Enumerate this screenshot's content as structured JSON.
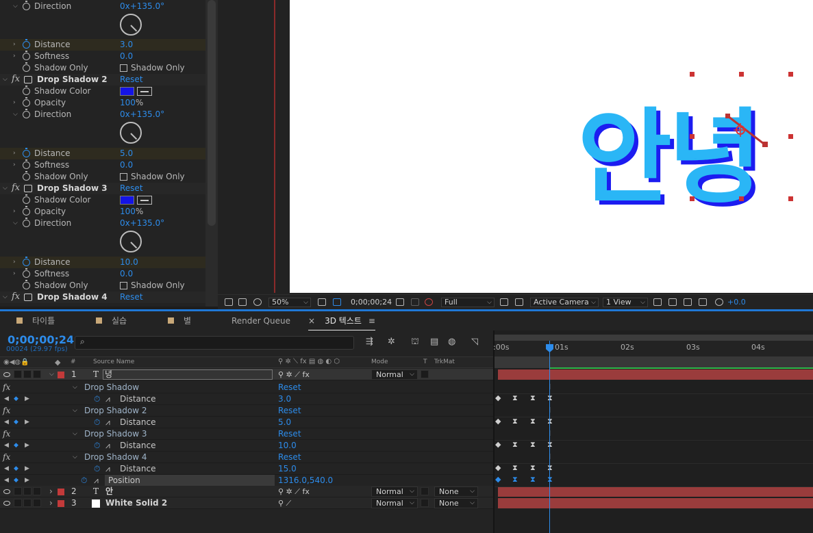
{
  "effect_controls": {
    "rows": [
      {
        "type": "prop",
        "twirl": "open",
        "label": "Direction",
        "value": "0x+135.0°"
      },
      {
        "type": "prop",
        "twirl": "closed",
        "label": "Distance",
        "value": "3.0",
        "stopwatch_on": true,
        "highlight": true
      },
      {
        "type": "prop",
        "twirl": "closed",
        "label": "Softness",
        "value": "0.0"
      },
      {
        "type": "check",
        "label": "Shadow Only",
        "check_label": "Shadow Only"
      },
      {
        "type": "effect",
        "name": "Drop Shadow 2",
        "reset": "Reset"
      },
      {
        "type": "color",
        "label": "Shadow Color",
        "color": "#1414e6"
      },
      {
        "type": "prop",
        "twirl": "closed",
        "label": "Opacity",
        "value": "100",
        "unit": "%"
      },
      {
        "type": "prop",
        "twirl": "open",
        "label": "Direction",
        "value": "0x+135.0°"
      },
      {
        "type": "prop",
        "twirl": "closed",
        "label": "Distance",
        "value": "5.0",
        "stopwatch_on": true,
        "highlight": true
      },
      {
        "type": "prop",
        "twirl": "closed",
        "label": "Softness",
        "value": "0.0"
      },
      {
        "type": "check",
        "label": "Shadow Only",
        "check_label": "Shadow Only"
      },
      {
        "type": "effect",
        "name": "Drop Shadow 3",
        "reset": "Reset"
      },
      {
        "type": "color",
        "label": "Shadow Color",
        "color": "#1414e6"
      },
      {
        "type": "prop",
        "twirl": "closed",
        "label": "Opacity",
        "value": "100",
        "unit": "%"
      },
      {
        "type": "prop",
        "twirl": "open",
        "label": "Direction",
        "value": "0x+135.0°"
      },
      {
        "type": "prop",
        "twirl": "closed",
        "label": "Distance",
        "value": "10.0",
        "stopwatch_on": true,
        "highlight": true
      },
      {
        "type": "prop",
        "twirl": "closed",
        "label": "Softness",
        "value": "0.0"
      },
      {
        "type": "check",
        "label": "Shadow Only",
        "check_label": "Shadow Only"
      },
      {
        "type": "effect",
        "name": "Drop Shadow 4",
        "reset": "Reset"
      }
    ]
  },
  "canvas": {
    "text": "안녕",
    "text_color": "#29b6f6",
    "shadow_color": "#1a1af0"
  },
  "viewer_bar": {
    "zoom": "50%",
    "timecode": "0;00;00;24",
    "resolution": "Full",
    "camera": "Active Camera",
    "views": "1 View",
    "exposure": "+0.0"
  },
  "tabs": [
    {
      "label": "타이틀",
      "color": "#c8a878"
    },
    {
      "label": "실습",
      "color": "#c8a878"
    },
    {
      "label": "별",
      "color": "#c8a878"
    },
    {
      "label": "Render Queue"
    },
    {
      "label": "3D 텍스트",
      "active": true,
      "close": "×",
      "menu": "≡"
    }
  ],
  "timeline": {
    "timecode": "0;00;00;24",
    "frame_info": "00024 (29.97 fps)",
    "columns": {
      "source": "Source Name",
      "mode": "Mode",
      "t": "T",
      "trkmat": "TrkMat",
      "num": "#"
    },
    "ruler": [
      ":00s",
      "01s",
      "02s",
      "03s",
      "04s"
    ],
    "layers": [
      {
        "num": "1",
        "name": "녕",
        "type": "T",
        "mode": "Normal",
        "trkmat": "",
        "selected": true
      },
      {
        "num": "2",
        "name": "안",
        "type": "T",
        "mode": "Normal",
        "trkmat": "None"
      },
      {
        "num": "3",
        "name": "White Solid 2",
        "type": "solid",
        "mode": "Normal",
        "trkmat": "None"
      }
    ],
    "effects": [
      {
        "name": "Drop Shadow",
        "reset": "Reset",
        "prop": "Distance",
        "value": "3.0"
      },
      {
        "name": "Drop Shadow 2",
        "reset": "Reset",
        "prop": "Distance",
        "value": "5.0"
      },
      {
        "name": "Drop Shadow 3",
        "reset": "Reset",
        "prop": "Distance",
        "value": "10.0"
      },
      {
        "name": "Drop Shadow 4",
        "reset": "Reset",
        "prop": "Distance",
        "value": "15.0"
      }
    ],
    "position": {
      "label": "Position",
      "value": "1316.0,540.0"
    }
  }
}
